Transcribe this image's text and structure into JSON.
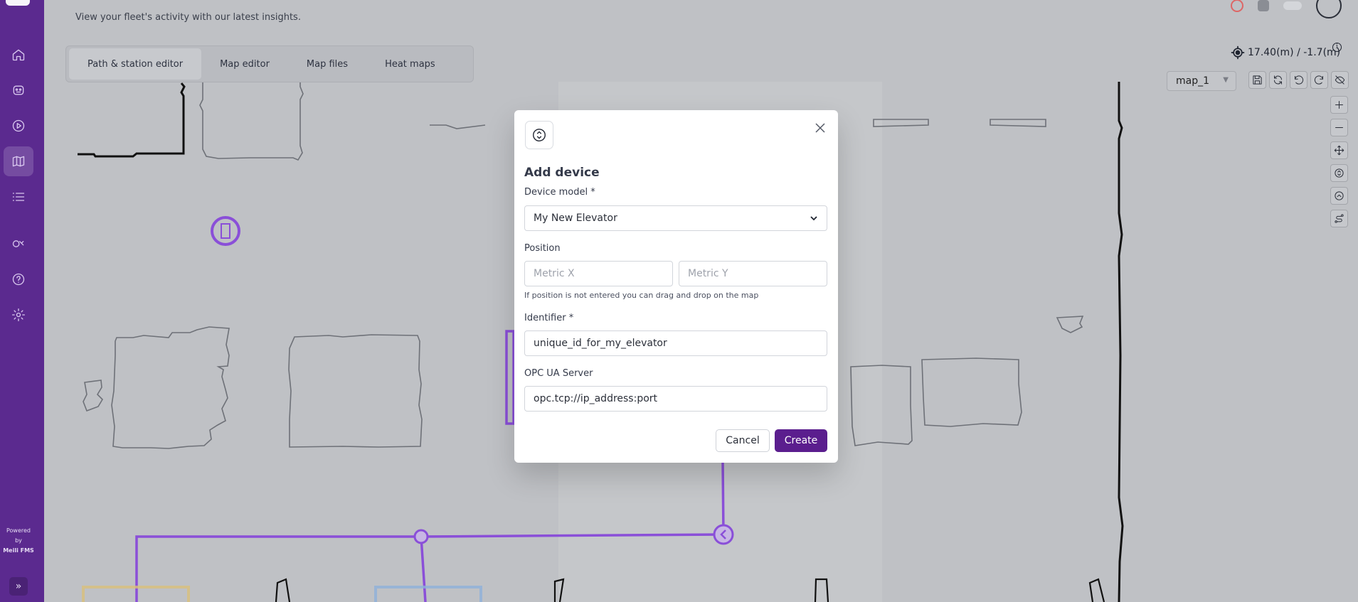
{
  "header": {
    "subtitle": "View your fleet's activity with our latest insights."
  },
  "tabs": [
    {
      "label": "Path & station editor",
      "active": true
    },
    {
      "label": "Map editor",
      "active": false
    },
    {
      "label": "Map files",
      "active": false
    },
    {
      "label": "Heat maps",
      "active": false
    }
  ],
  "sidebar": {
    "items": [
      {
        "icon": "home-icon"
      },
      {
        "icon": "robot-icon"
      },
      {
        "icon": "play-icon"
      },
      {
        "icon": "map-icon",
        "active": true
      },
      {
        "icon": "list-icon"
      },
      {
        "icon": "devices-icon"
      },
      {
        "icon": "help-icon"
      },
      {
        "icon": "settings-icon"
      }
    ],
    "powered_line1": "Powered",
    "powered_line2": "by",
    "powered_brand": "Meili FMS",
    "expand_glyph": "»"
  },
  "map_toolbar": {
    "coords": "17.40(m) / -1.7(m)",
    "map_selected": "map_1"
  },
  "modal": {
    "title": "Add device",
    "device_model_label": "Device model *",
    "device_model_value": "My New Elevator",
    "position_label": "Position",
    "metric_x_placeholder": "Metric X",
    "metric_y_placeholder": "Metric Y",
    "position_hint": "If position is not entered you can drag and drop on the map",
    "identifier_label": "Identifier *",
    "identifier_value": "unique_id_for_my_elevator",
    "opc_label": "OPC UA Server",
    "opc_value": "opc.tcp://ip_address:port",
    "cancel_label": "Cancel",
    "create_label": "Create"
  },
  "colors": {
    "sidebar": "#5b2a8f",
    "primary": "#5b1e8e",
    "path": "#8a4fd8"
  }
}
